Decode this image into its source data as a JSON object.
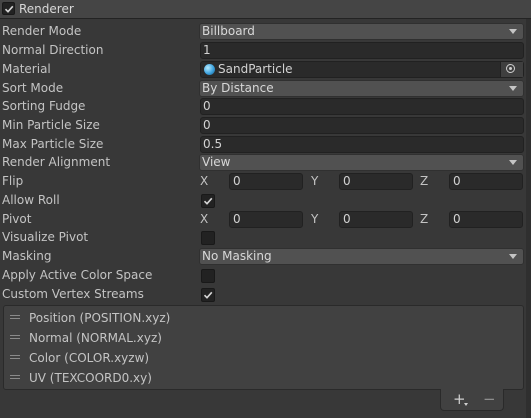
{
  "header": {
    "title": "Renderer",
    "enabled": true
  },
  "props": {
    "render_mode": {
      "label": "Render Mode",
      "value": "Billboard"
    },
    "normal_direction": {
      "label": "Normal Direction",
      "value": "1"
    },
    "material": {
      "label": "Material",
      "value": "SandParticle",
      "icon": "sphere-material-icon"
    },
    "sort_mode": {
      "label": "Sort Mode",
      "value": "By Distance"
    },
    "sorting_fudge": {
      "label": "Sorting Fudge",
      "value": "0"
    },
    "min_particle_size": {
      "label": "Min Particle Size",
      "value": "0"
    },
    "max_particle_size": {
      "label": "Max Particle Size",
      "value": "0.5"
    },
    "render_alignment": {
      "label": "Render Alignment",
      "value": "View"
    },
    "flip": {
      "label": "Flip",
      "x_label": "X",
      "x": "0",
      "y_label": "Y",
      "y": "0",
      "z_label": "Z",
      "z": "0"
    },
    "allow_roll": {
      "label": "Allow Roll",
      "checked": true
    },
    "pivot": {
      "label": "Pivot",
      "x_label": "X",
      "x": "0",
      "y_label": "Y",
      "y": "0",
      "z_label": "Z",
      "z": "0"
    },
    "visualize_pivot": {
      "label": "Visualize Pivot",
      "checked": false
    },
    "masking": {
      "label": "Masking",
      "value": "No Masking"
    },
    "apply_active_color_space": {
      "label": "Apply Active Color Space",
      "checked": false
    },
    "custom_vertex_streams": {
      "label": "Custom Vertex Streams",
      "checked": true
    }
  },
  "streams": [
    {
      "label": "Position (POSITION.xyz)"
    },
    {
      "label": "Normal (NORMAL.xyz)"
    },
    {
      "label": "Color (COLOR.xyzw)"
    },
    {
      "label": "UV (TEXCOORD0.xy)"
    }
  ],
  "footer": {
    "add_label": "+",
    "remove_label": "−"
  },
  "colors": {
    "background": "#383838",
    "field": "#2a2a2a",
    "dropdown": "#515151",
    "text": "#c4c4c4"
  }
}
